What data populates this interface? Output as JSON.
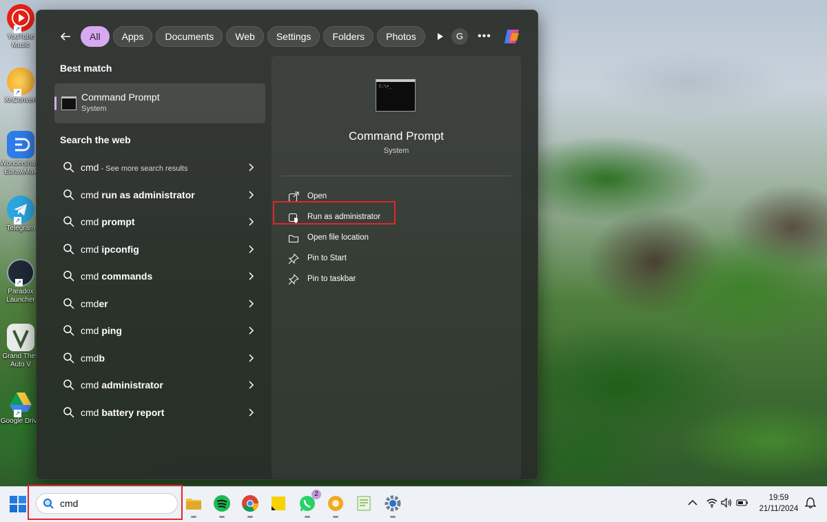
{
  "desktop_icons": [
    {
      "label": "YouTube Music",
      "color": "#e62117"
    },
    {
      "label": "XnConvert",
      "color": "#f5a623"
    },
    {
      "label": "Wondershare EdrawMax",
      "color": "#2f7dea"
    },
    {
      "label": "Telegram",
      "color": "#2ca5e0"
    },
    {
      "label": "Paradox Launcher",
      "color": "#1f2a36"
    },
    {
      "label": "Grand Theft Auto V",
      "color": "#e9ece8"
    },
    {
      "label": "Google Drive",
      "color": "#ffffff"
    }
  ],
  "start": {
    "filters": [
      "All",
      "Apps",
      "Documents",
      "Web",
      "Settings",
      "Folders",
      "Photos"
    ],
    "active_filter": "All",
    "account_initial": "G",
    "more_label": "•••",
    "best_match": {
      "heading": "Best match",
      "title": "Command Prompt",
      "subtitle": "System"
    },
    "web": {
      "heading": "Search the web",
      "items": [
        {
          "prefix": "cmd",
          "bold": "",
          "hint": " - See more search results"
        },
        {
          "prefix": "cmd ",
          "bold": "run as administrator",
          "hint": ""
        },
        {
          "prefix": "cmd ",
          "bold": "prompt",
          "hint": ""
        },
        {
          "prefix": "cmd ",
          "bold": "ipconfig",
          "hint": ""
        },
        {
          "prefix": "cmd ",
          "bold": "commands",
          "hint": ""
        },
        {
          "prefix": "cmd",
          "bold": "er",
          "hint": ""
        },
        {
          "prefix": "cmd ",
          "bold": "ping",
          "hint": ""
        },
        {
          "prefix": "cmd",
          "bold": "b",
          "hint": ""
        },
        {
          "prefix": "cmd ",
          "bold": "administrator",
          "hint": ""
        },
        {
          "prefix": "cmd ",
          "bold": "battery report",
          "hint": ""
        }
      ]
    },
    "detail": {
      "title": "Command Prompt",
      "subtitle": "System",
      "icon_text": "C:\\>_",
      "actions": [
        {
          "label": "Open",
          "icon": "open-icon"
        },
        {
          "label": "Run as administrator",
          "icon": "shield-icon"
        },
        {
          "label": "Open file location",
          "icon": "folder-icon"
        },
        {
          "label": "Pin to Start",
          "icon": "pin-icon"
        },
        {
          "label": "Pin to taskbar",
          "icon": "pin-icon"
        }
      ]
    }
  },
  "taskbar": {
    "search_value": "cmd",
    "apps": [
      {
        "name": "file-explorer",
        "color": "#f4c542"
      },
      {
        "name": "spotify",
        "color": "#1db954"
      },
      {
        "name": "chrome",
        "color": "#4285f4"
      },
      {
        "name": "sticky-notes",
        "color": "#f7d200"
      },
      {
        "name": "whatsapp",
        "color": "#25d366",
        "badge": "2"
      },
      {
        "name": "xnconvert",
        "color": "#f5a623"
      },
      {
        "name": "notepad",
        "color": "#7cb342"
      },
      {
        "name": "settings",
        "color": "#6b7b8c"
      }
    ],
    "time": "19:59",
    "date": "21/11/2024"
  },
  "colors": {
    "accent": "#d7a9f0",
    "highlight": "#e0262c"
  }
}
